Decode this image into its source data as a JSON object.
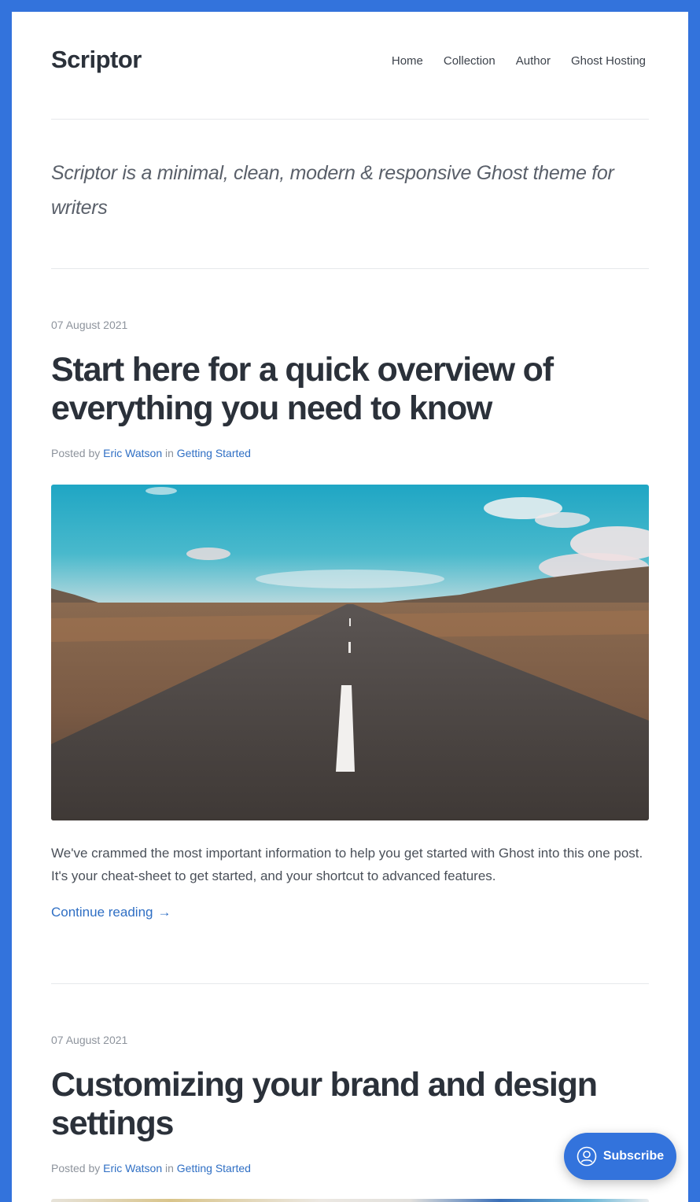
{
  "site": {
    "title": "Scriptor",
    "nav": [
      "Home",
      "Collection",
      "Author",
      "Ghost Hosting"
    ],
    "tagline": "Scriptor is a minimal, clean, modern & responsive Ghost theme for writers"
  },
  "posts": [
    {
      "date": "07 August 2021",
      "title": "Start here for a quick overview of everything you need to know",
      "posted_by": "Posted by",
      "author": "Eric Watson",
      "in": "in",
      "tag": "Getting Started",
      "excerpt": "We've crammed the most important information to help you get started with Ghost into this one post. It's your cheat-sheet to get started, and your shortcut to advanced features.",
      "continue_label": "Continue reading"
    },
    {
      "date": "07 August 2021",
      "title": "Customizing your brand and design settings",
      "posted_by": "Posted by",
      "author": "Eric Watson",
      "in": "in",
      "tag": "Getting Started"
    }
  ],
  "subscribe": {
    "label": "Subscribe"
  },
  "colors": {
    "frame": "#3373dc",
    "link": "#2f6fc4",
    "text": "#2b313a"
  }
}
